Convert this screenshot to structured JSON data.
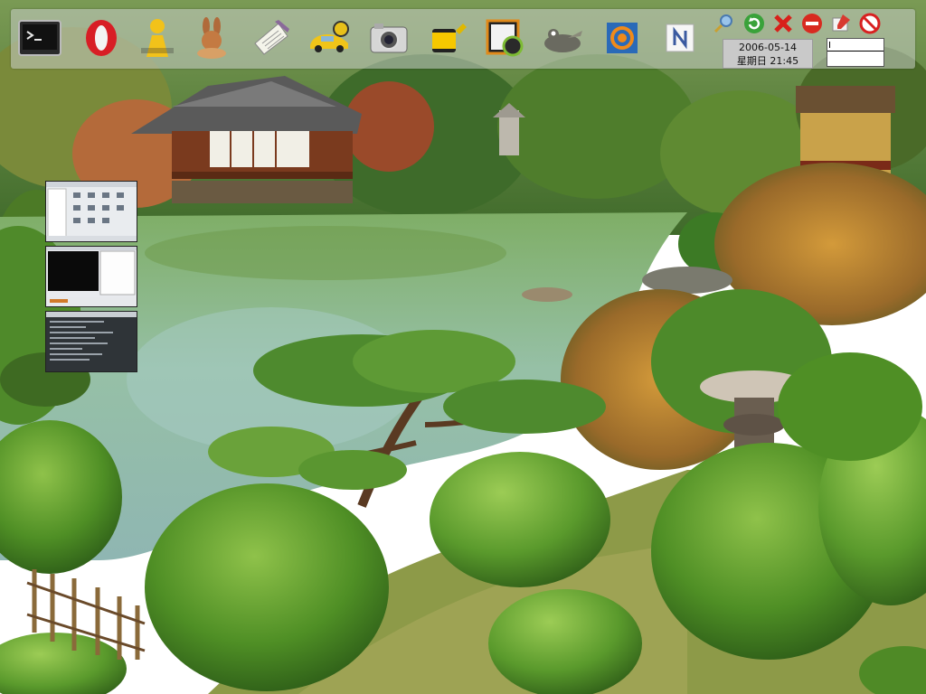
{
  "desktop": {
    "wallpaper": "japanese-garden-pond-photo"
  },
  "topbar": {
    "launchers": [
      {
        "id": "terminal",
        "icon": "terminal-icon"
      },
      {
        "id": "opera",
        "icon": "opera-browser-icon"
      },
      {
        "id": "aim",
        "icon": "aim-messenger-icon"
      },
      {
        "id": "bunny",
        "icon": "bunny-app-icon"
      },
      {
        "id": "text-editor",
        "icon": "text-editor-icon"
      },
      {
        "id": "car",
        "icon": "car-game-icon"
      },
      {
        "id": "camera",
        "icon": "camera-icon"
      },
      {
        "id": "film",
        "icon": "film-roll-icon"
      },
      {
        "id": "media",
        "icon": "media-player-icon"
      },
      {
        "id": "gimp",
        "icon": "gimp-icon"
      },
      {
        "id": "spiral",
        "icon": "spiral-app-icon"
      },
      {
        "id": "notes",
        "icon": "notes-app-icon"
      }
    ],
    "tray": [
      "search-tray-icon",
      "refresh-tray-icon",
      "close-tray-icon",
      "minus-tray-icon",
      "edit-tray-icon",
      "no-entry-tray-icon"
    ],
    "clock": {
      "date": "2006-05-14",
      "weekday_time": "星期日 21:45"
    }
  },
  "pager": {
    "workspaces": [
      {
        "name": "workspace-1",
        "content": "file-manager"
      },
      {
        "name": "workspace-2",
        "content": "video-and-editor"
      },
      {
        "name": "workspace-3",
        "content": "terminal"
      }
    ]
  }
}
